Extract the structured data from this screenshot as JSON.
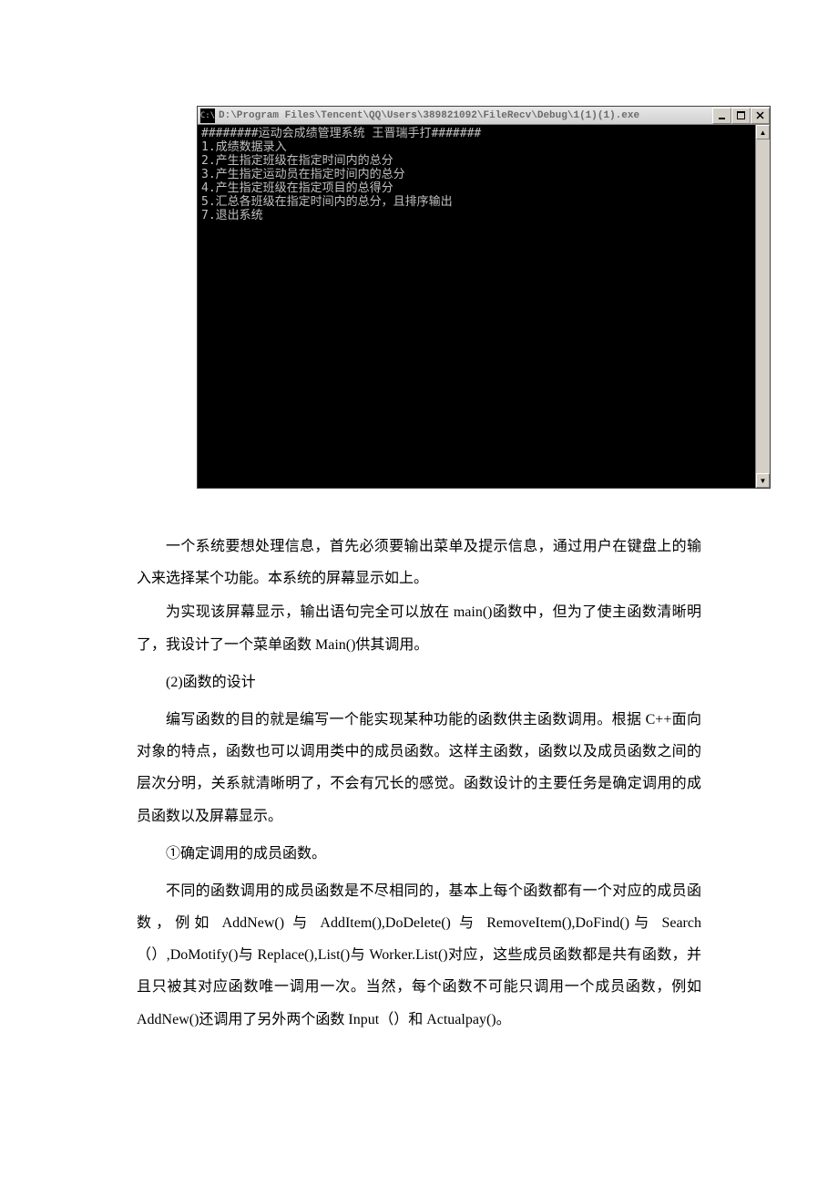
{
  "console": {
    "icon_text": "C:\\",
    "title": "D:\\Program Files\\Tencent\\QQ\\Users\\389821092\\FileRecv\\Debug\\1(1)(1).exe",
    "lines": [
      "########运动会成绩管理系统 王晋瑞手打#######",
      "1.成绩数据录入",
      "2.产生指定班级在指定时间内的总分",
      "3.产生指定运动员在指定时间内的总分",
      "4.产生指定班级在指定项目的总得分",
      "5.汇总各班级在指定时间内的总分，且排序输出",
      "7.退出系统"
    ]
  },
  "doc": {
    "p1": "一个系统要想处理信息，首先必须要输出菜单及提示信息，通过用户在键盘上的输入来选择某个功能。本系统的屏幕显示如上。",
    "p2": "为实现该屏幕显示，输出语句完全可以放在 main()函数中，但为了使主函数清晰明了，我设计了一个菜单函数 Main()供其调用。",
    "h1": "(2)函数的设计",
    "p3": "编写函数的目的就是编写一个能实现某种功能的函数供主函数调用。根据 C++面向对象的特点，函数也可以调用类中的成员函数。这样主函数，函数以及成员函数之间的层次分明，关系就清晰明了，不会有冗长的感觉。函数设计的主要任务是确定调用的成员函数以及屏幕显示。",
    "h2": "①确定调用的成员函数。",
    "p4": "不同的函数调用的成员函数是不尽相同的，基本上每个函数都有一个对应的成员函数，例如 AddNew() 与 AddItem(),DoDelete() 与 RemoveItem(),DoFind()与 Search（）,DoMotify()与 Replace(),List()与 Worker.List()对应，这些成员函数都是共有函数，并且只被其对应函数唯一调用一次。当然，每个函数不可能只调用一个成员函数，例如 AddNew()还调用了另外两个函数 Input（）和 Actualpay()。"
  }
}
